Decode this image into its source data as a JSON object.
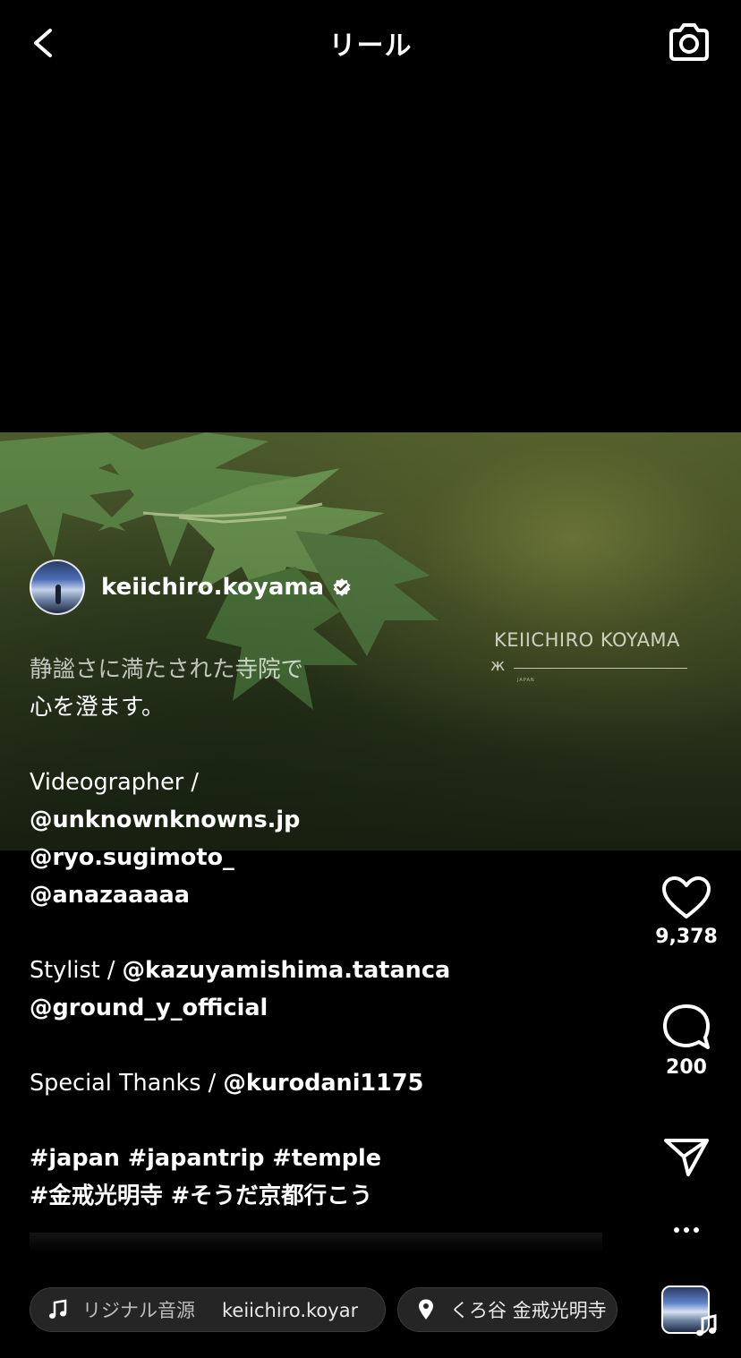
{
  "header": {
    "title": "リール"
  },
  "video": {
    "watermark_name": "KEIICHIRO KOYAMA",
    "watermark_mark": "ж",
    "watermark_sub": "JAPAN"
  },
  "post": {
    "username": "keiichiro.koyama",
    "verified": true,
    "caption": {
      "line1": "静謐さに満たされた寺院で",
      "line2": "心を澄ます。",
      "videographer_label": "Videographer /",
      "videographer_1": "@unknownknowns.jp",
      "videographer_2": "@ryo.sugimoto_",
      "videographer_3": "@anazaaaaa",
      "stylist_label": "Stylist / ",
      "stylist_1": "@kazuyamishima.tatanca",
      "stylist_2": "@ground_y_official",
      "thanks_label": "Special Thanks / ",
      "thanks_1": "@kurodani1175",
      "tags_1": "#japan #japantrip #temple",
      "tags_2": "#金戒光明寺 #そうだ京都行こう"
    }
  },
  "actions": {
    "likes": "9,378",
    "comments": "200"
  },
  "bottom": {
    "audio_label": "リジナル音源",
    "audio_user": "keiichiro.koyar",
    "location": "くろ谷 金戒光明寺"
  },
  "icons": {
    "back": "chevron-left-icon",
    "camera": "camera-icon",
    "like": "heart-icon",
    "comment": "comment-icon",
    "share": "send-icon",
    "more": "more-icon",
    "audio": "music-note-icon",
    "location": "location-pin-icon"
  }
}
